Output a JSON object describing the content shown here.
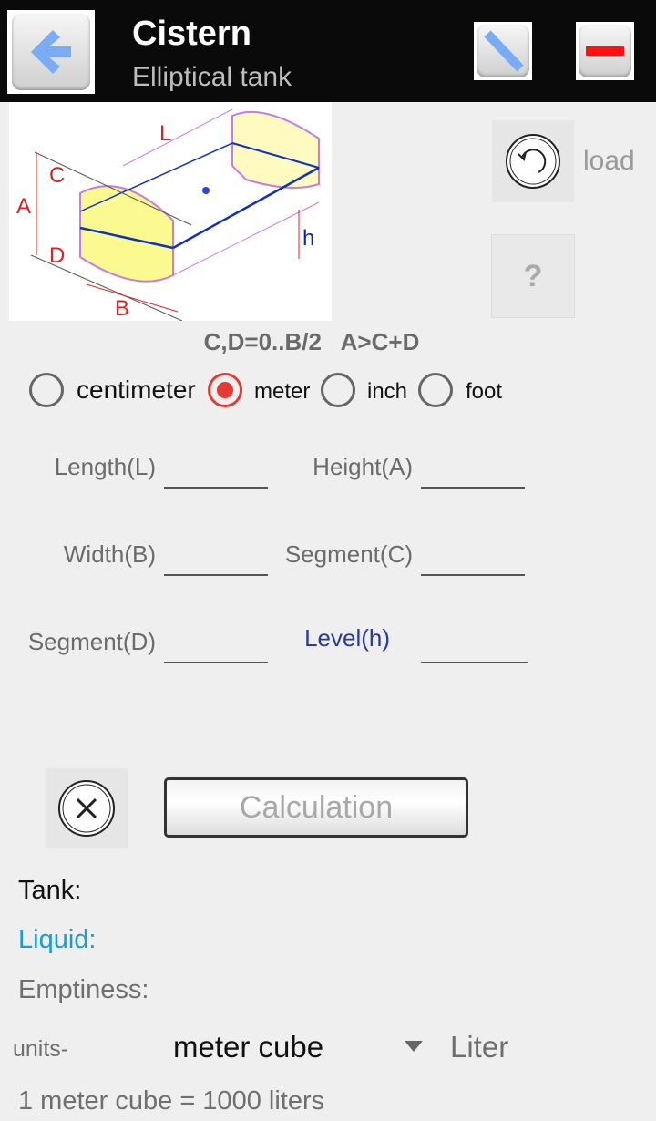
{
  "header": {
    "title": "Cistern",
    "subtitle": "Elliptical tank",
    "back_icon": "arrow-left-icon",
    "edit_icon": "ruler-slash-icon",
    "minus_icon": "minus-icon"
  },
  "diagram": {
    "labels": {
      "L": "L",
      "A": "A",
      "B": "B",
      "C": "C",
      "D": "D",
      "h": "h"
    }
  },
  "load": {
    "label": "load",
    "icon": "undo-circle-icon"
  },
  "help": {
    "label": "?"
  },
  "constraint": "C,D=0..B/2   A>C+D",
  "units_radio": [
    {
      "label": "centimeter",
      "checked": false
    },
    {
      "label": "meter",
      "checked": true
    },
    {
      "label": "inch",
      "checked": false
    },
    {
      "label": "foot",
      "checked": false
    }
  ],
  "fields": {
    "length": {
      "label": "Length(L)",
      "value": ""
    },
    "height": {
      "label": "Height(A)",
      "value": ""
    },
    "width": {
      "label": "Width(B)",
      "value": ""
    },
    "segment_c": {
      "label": "Segment(C)",
      "value": ""
    },
    "segment_d": {
      "label": "Segment(D)",
      "value": ""
    },
    "level": {
      "label": "Level(h)",
      "value": ""
    }
  },
  "calculation_label": "Calculation",
  "results": {
    "tank": "Tank:",
    "liquid": "Liquid:",
    "emptiness": "Emptiness:"
  },
  "units_row": {
    "prefix": "units-",
    "selected": "meter cube",
    "secondary": "Liter"
  },
  "conversion": "1 meter cube = 1000 liters",
  "colors": {
    "accent": "#e53935",
    "liquid": "#1a9ccc",
    "level": "#2a3a9a"
  }
}
